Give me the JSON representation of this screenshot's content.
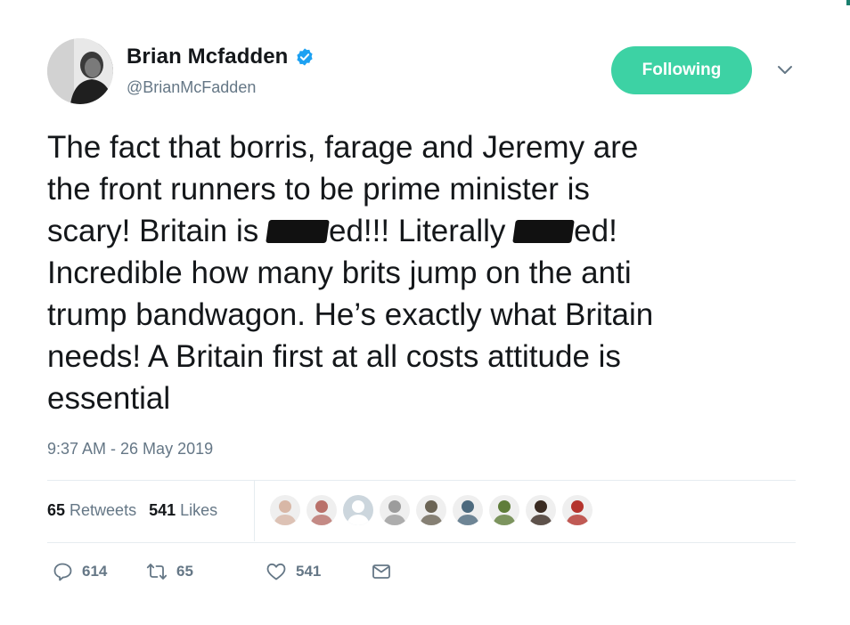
{
  "author": {
    "name": "Brian Mcfadden",
    "handle": "@BrianMcFadden",
    "verified": true
  },
  "follow_button": {
    "label": "Following",
    "color": "#3dd2a4"
  },
  "tweet": {
    "lines": [
      [
        "The fact that borris, farage and Jeremy are"
      ],
      [
        "the front runners to be prime minister is"
      ],
      [
        "scary! Britain is ",
        "ed!!! Literally ",
        "ed!"
      ],
      [
        "Incredible how many brits jump on the anti"
      ],
      [
        "trump bandwagon. He’s exactly what Britain"
      ],
      [
        "needs! A Britain first at all costs attitude is"
      ],
      [
        "essential"
      ]
    ],
    "timestamp": "9:37 AM - 26 May 2019"
  },
  "stats": {
    "retweets_count": "65",
    "retweets_label": "Retweets",
    "likes_count": "541",
    "likes_label": "Likes"
  },
  "likers": [
    {
      "icon": "avatar-photo",
      "color": "#d8b7a6"
    },
    {
      "icon": "avatar-photo",
      "color": "#b9716a"
    },
    {
      "icon": "default-avatar-icon",
      "color": "#a5b2bd"
    },
    {
      "icon": "avatar-photo",
      "color": "#9c9c9c"
    },
    {
      "icon": "avatar-photo",
      "color": "#6b6455"
    },
    {
      "icon": "avatar-photo",
      "color": "#4d6a7e"
    },
    {
      "icon": "avatar-photo",
      "color": "#5f7d3a"
    },
    {
      "icon": "avatar-photo",
      "color": "#3a2b22"
    },
    {
      "icon": "avatar-photo",
      "color": "#b4342d"
    }
  ],
  "actions": {
    "reply_count": "614",
    "retweet_count": "65",
    "like_count": "541"
  },
  "colors": {
    "text": "#14171a",
    "secondary": "#657786",
    "verified_blue": "#1da1f2",
    "divider": "#e6ecf0"
  }
}
